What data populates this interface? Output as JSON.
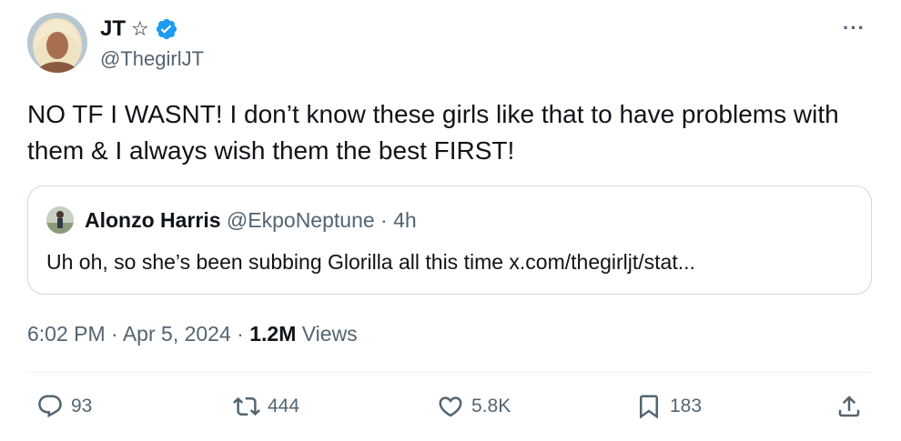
{
  "author": {
    "display_name": "JT",
    "star_badge": "☆",
    "handle": "@ThegirlJT",
    "verified_color": "#1d9bf0"
  },
  "tweet": {
    "text": "NO TF I WASNT! I don’t know these girls like that to have problems with them & I always wish them the best FIRST!",
    "time": "6:02 PM",
    "date": "Apr 5, 2024",
    "views_count": "1.2M",
    "views_label": "Views"
  },
  "quote": {
    "name": "Alonzo Harris",
    "handle": "@EkpoNeptune",
    "age": "4h",
    "text": "Uh oh, so she’s been subbing Glorilla all this time x.com/thegirljt/stat..."
  },
  "actions": {
    "replies": "93",
    "reposts": "444",
    "likes": "5.8K",
    "bookmarks": "183"
  },
  "icons": [
    "more-icon",
    "verified-icon",
    "reply-icon",
    "repost-icon",
    "like-icon",
    "bookmark-icon",
    "share-icon"
  ],
  "colors": {
    "text": "#0f1419",
    "secondary": "#536471",
    "border": "#cfd9de",
    "accent": "#1d9bf0"
  }
}
